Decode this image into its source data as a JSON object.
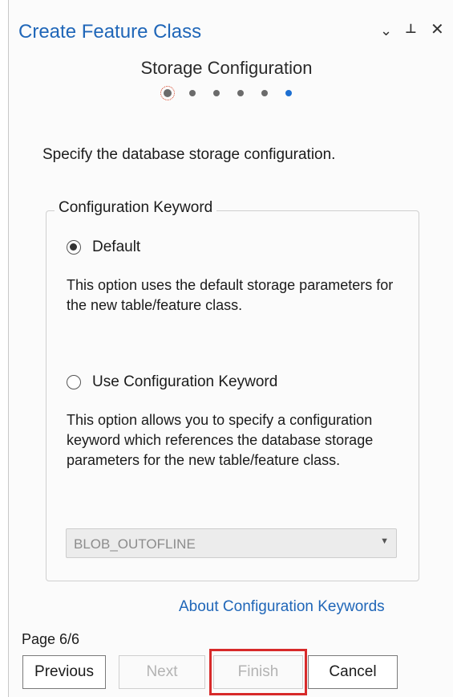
{
  "window": {
    "title": "Create Feature Class",
    "controls": {
      "dropdown_icon": "⌄",
      "pin_icon": "⊥",
      "close_icon": "✕"
    }
  },
  "step": {
    "title": "Storage Configuration",
    "total_dots": 6,
    "current": 6
  },
  "instruction": "Specify the database storage configuration.",
  "config_group": {
    "legend": "Configuration Keyword",
    "options": [
      {
        "label": "Default",
        "selected": true,
        "description": "This option uses the default storage parameters for the new table/feature class."
      },
      {
        "label": "Use Configuration Keyword",
        "selected": false,
        "description": "This option allows you to specify a configuration keyword which references the database storage parameters for the new table/feature class."
      }
    ],
    "keyword_select": {
      "value": "BLOB_OUTOFLINE",
      "disabled": true
    }
  },
  "help_link": "About Configuration Keywords",
  "page_indicator": "Page 6/6",
  "buttons": {
    "previous": "Previous",
    "next": "Next",
    "finish": "Finish",
    "cancel": "Cancel"
  },
  "colors": {
    "title": "#1f66b8",
    "highlight": "#d72a2a",
    "active_dot": "#1d6fd1"
  }
}
